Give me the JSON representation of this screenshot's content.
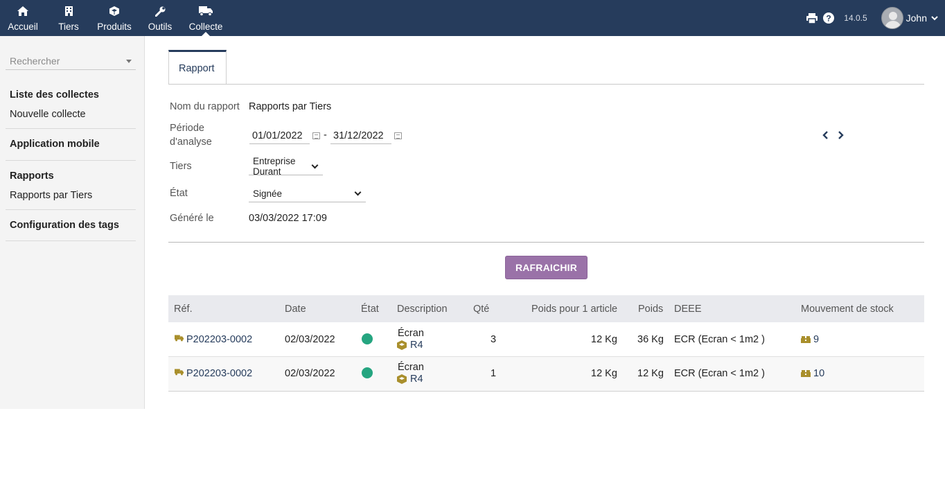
{
  "topnav": {
    "items": [
      {
        "label": "Accueil",
        "icon": "home-icon"
      },
      {
        "label": "Tiers",
        "icon": "building-icon"
      },
      {
        "label": "Produits",
        "icon": "cube-icon"
      },
      {
        "label": "Outils",
        "icon": "wrench-icon"
      },
      {
        "label": "Collecte",
        "icon": "truck-icon",
        "active": true
      }
    ],
    "version": "14.0.5",
    "user": "John",
    "color": "#263c5c"
  },
  "sidebar": {
    "search_placeholder": "Rechercher",
    "sections": [
      {
        "title": "Liste des collectes",
        "links": [
          "Nouvelle collecte"
        ]
      },
      {
        "title": "Application mobile",
        "links": []
      },
      {
        "title": "Rapports",
        "links": [
          "Rapports par Tiers"
        ]
      },
      {
        "title": "Configuration des tags",
        "links": []
      }
    ]
  },
  "main": {
    "tab": "Rapport",
    "fields": {
      "report_name_label": "Nom du rapport",
      "report_name": "Rapports par Tiers",
      "period_label_1": "Période",
      "period_label_2": "d'analyse",
      "date_from": "01/01/2022",
      "date_sep": "-",
      "date_to": "31/12/2022",
      "tiers_label": "Tiers",
      "tiers_value": "Entreprise Durant",
      "etat_label": "État",
      "etat_value": "Signée",
      "generated_label": "Généré le",
      "generated_value": "03/03/2022 17:09"
    },
    "refresh_button": "RAFRAICHIR",
    "refresh_color": "#9a72a8"
  },
  "table": {
    "headers": [
      "Réf.",
      "Date",
      "État",
      "Description",
      "Qté",
      "Poids pour 1 article",
      "Poids",
      "DEEE",
      "Mouvement de stock"
    ],
    "rows": [
      {
        "ref": "P202203-0002",
        "date": "02/03/2022",
        "status_color": "#25a580",
        "desc_1": "Écran",
        "desc_2": "R4",
        "qty": "3",
        "poids_unit": "12 Kg",
        "poids": "36 Kg",
        "deee": "ECR (Ecran < 1m2 )",
        "mouvement": "9"
      },
      {
        "ref": "P202203-0002",
        "date": "02/03/2022",
        "status_color": "#25a580",
        "desc_1": "Écran",
        "desc_2": "R4",
        "qty": "1",
        "poids_unit": "12 Kg",
        "poids": "12 Kg",
        "deee": "ECR (Ecran < 1m2 )",
        "mouvement": "10"
      }
    ]
  }
}
